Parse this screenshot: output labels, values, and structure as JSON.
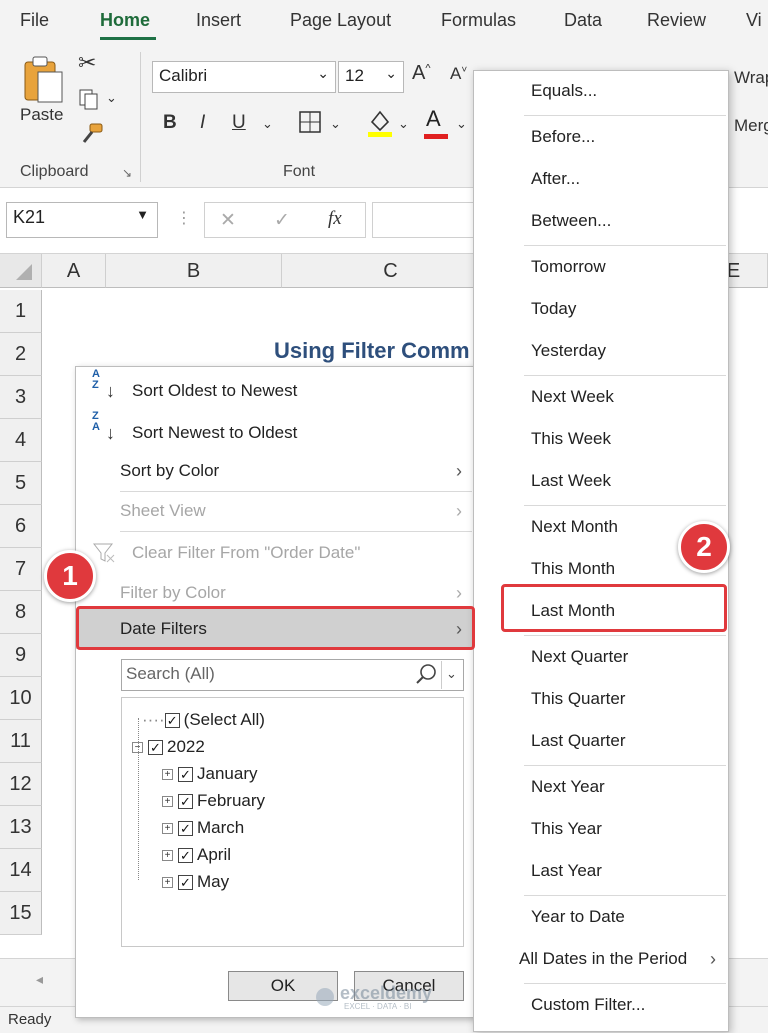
{
  "ribbon_tabs": [
    "File",
    "Home",
    "Insert",
    "Page Layout",
    "Formulas",
    "Data",
    "Review",
    "Vi"
  ],
  "clipboard": {
    "paste_label": "Paste",
    "group_label": "Clipboard"
  },
  "font": {
    "name": "Calibri",
    "size": "12",
    "group_label": "Font",
    "bold": "B",
    "italic": "I",
    "underline": "U",
    "grow": "A^",
    "shrink": "A˅",
    "fill_letter": "",
    "font_color_letter": "A"
  },
  "alignment": {
    "wrap_label": "Wrap",
    "merge_label": "Merg"
  },
  "formula_bar": {
    "name_box": "K21",
    "fx": "fx",
    "cancel": "✕",
    "enter": "✓"
  },
  "columns": [
    "A",
    "B",
    "C",
    "E"
  ],
  "rows": [
    "1",
    "2",
    "3",
    "4",
    "5",
    "6",
    "7",
    "8",
    "9",
    "10",
    "11",
    "12",
    "13",
    "14",
    "15"
  ],
  "sheet_title": "Using Filter Comm",
  "filter_menu": {
    "sort_oldest": "Sort Oldest to Newest",
    "sort_newest": "Sort Newest to Oldest",
    "sort_by_color": "Sort by Color",
    "sheet_view": "Sheet View",
    "clear_filter": "Clear Filter From \"Order Date\"",
    "filter_by_color": "Filter by Color",
    "date_filters": "Date Filters",
    "search_placeholder": "Search (All)",
    "tree": [
      "(Select All)",
      "2022",
      "January",
      "February",
      "March",
      "April",
      "May"
    ],
    "ok": "OK",
    "cancel": "Cancel"
  },
  "date_submenu": [
    "Equals...",
    "Before...",
    "After...",
    "Between...",
    "Tomorrow",
    "Today",
    "Yesterday",
    "Next Week",
    "This Week",
    "Last Week",
    "Next Month",
    "This Month",
    "Last Month",
    "Next Quarter",
    "This Quarter",
    "Last Quarter",
    "Next Year",
    "This Year",
    "Last Year",
    "Year to Date",
    "All Dates in the Period",
    "Custom Filter..."
  ],
  "callouts": [
    "1",
    "2"
  ],
  "status": "Ready",
  "watermark": "exceldemy",
  "watermark_sub": "EXCEL · DATA · BI",
  "colors": {
    "accent": "#1e7145",
    "highlight": "#e0393d",
    "title": "#2e4f7c"
  }
}
